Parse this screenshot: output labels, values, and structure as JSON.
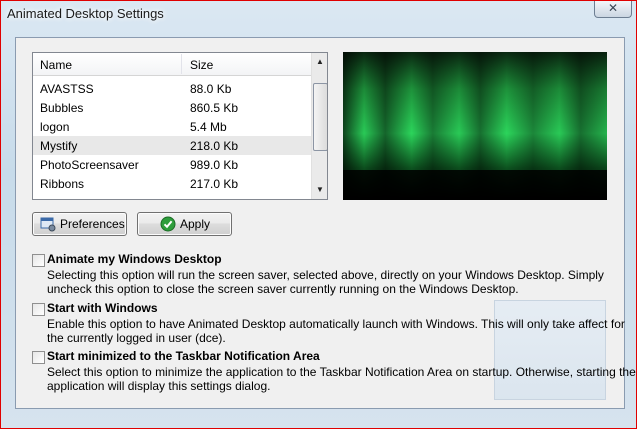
{
  "window": {
    "title": "Animated Desktop Settings",
    "close_glyph": "✕"
  },
  "list": {
    "columns": {
      "name": "Name",
      "size": "Size"
    },
    "rows": [
      {
        "name": "AVASTSS",
        "size": "88.0 Kb"
      },
      {
        "name": "Bubbles",
        "size": "860.5 Kb"
      },
      {
        "name": "logon",
        "size": "5.4 Mb"
      },
      {
        "name": "Mystify",
        "size": "218.0 Kb"
      },
      {
        "name": "PhotoScreensaver",
        "size": "989.0 Kb"
      },
      {
        "name": "Ribbons",
        "size": "217.0 Kb"
      }
    ],
    "selected_index": 3,
    "scroll_up_glyph": "▲",
    "scroll_down_glyph": "▼"
  },
  "buttons": {
    "preferences": "Preferences",
    "apply": "Apply"
  },
  "options": [
    {
      "title": "Animate my Windows Desktop",
      "description": "Selecting this option will run the screen saver, selected above, directly on your Windows Desktop.  Simply uncheck this option to close the screen saver currently running on the Windows Desktop.",
      "checked": false
    },
    {
      "title": "Start with Windows",
      "description": "Enable this option to have Animated Desktop automatically launch with Windows.  This will only take affect for the currently logged in user (dce).",
      "checked": false
    },
    {
      "title": "Start minimized to the Taskbar Notification Area",
      "description": "Select this option to minimize the application to the Taskbar Notification Area on startup.  Otherwise, starting the application will display this settings dialog.",
      "checked": false
    }
  ],
  "colors": {
    "frame_border": "#e00000",
    "aurora_green": "#2ee060",
    "apply_icon": "#2e9e3c"
  },
  "icons": {
    "preferences": "preferences-window-icon",
    "apply": "check-circle-icon"
  }
}
